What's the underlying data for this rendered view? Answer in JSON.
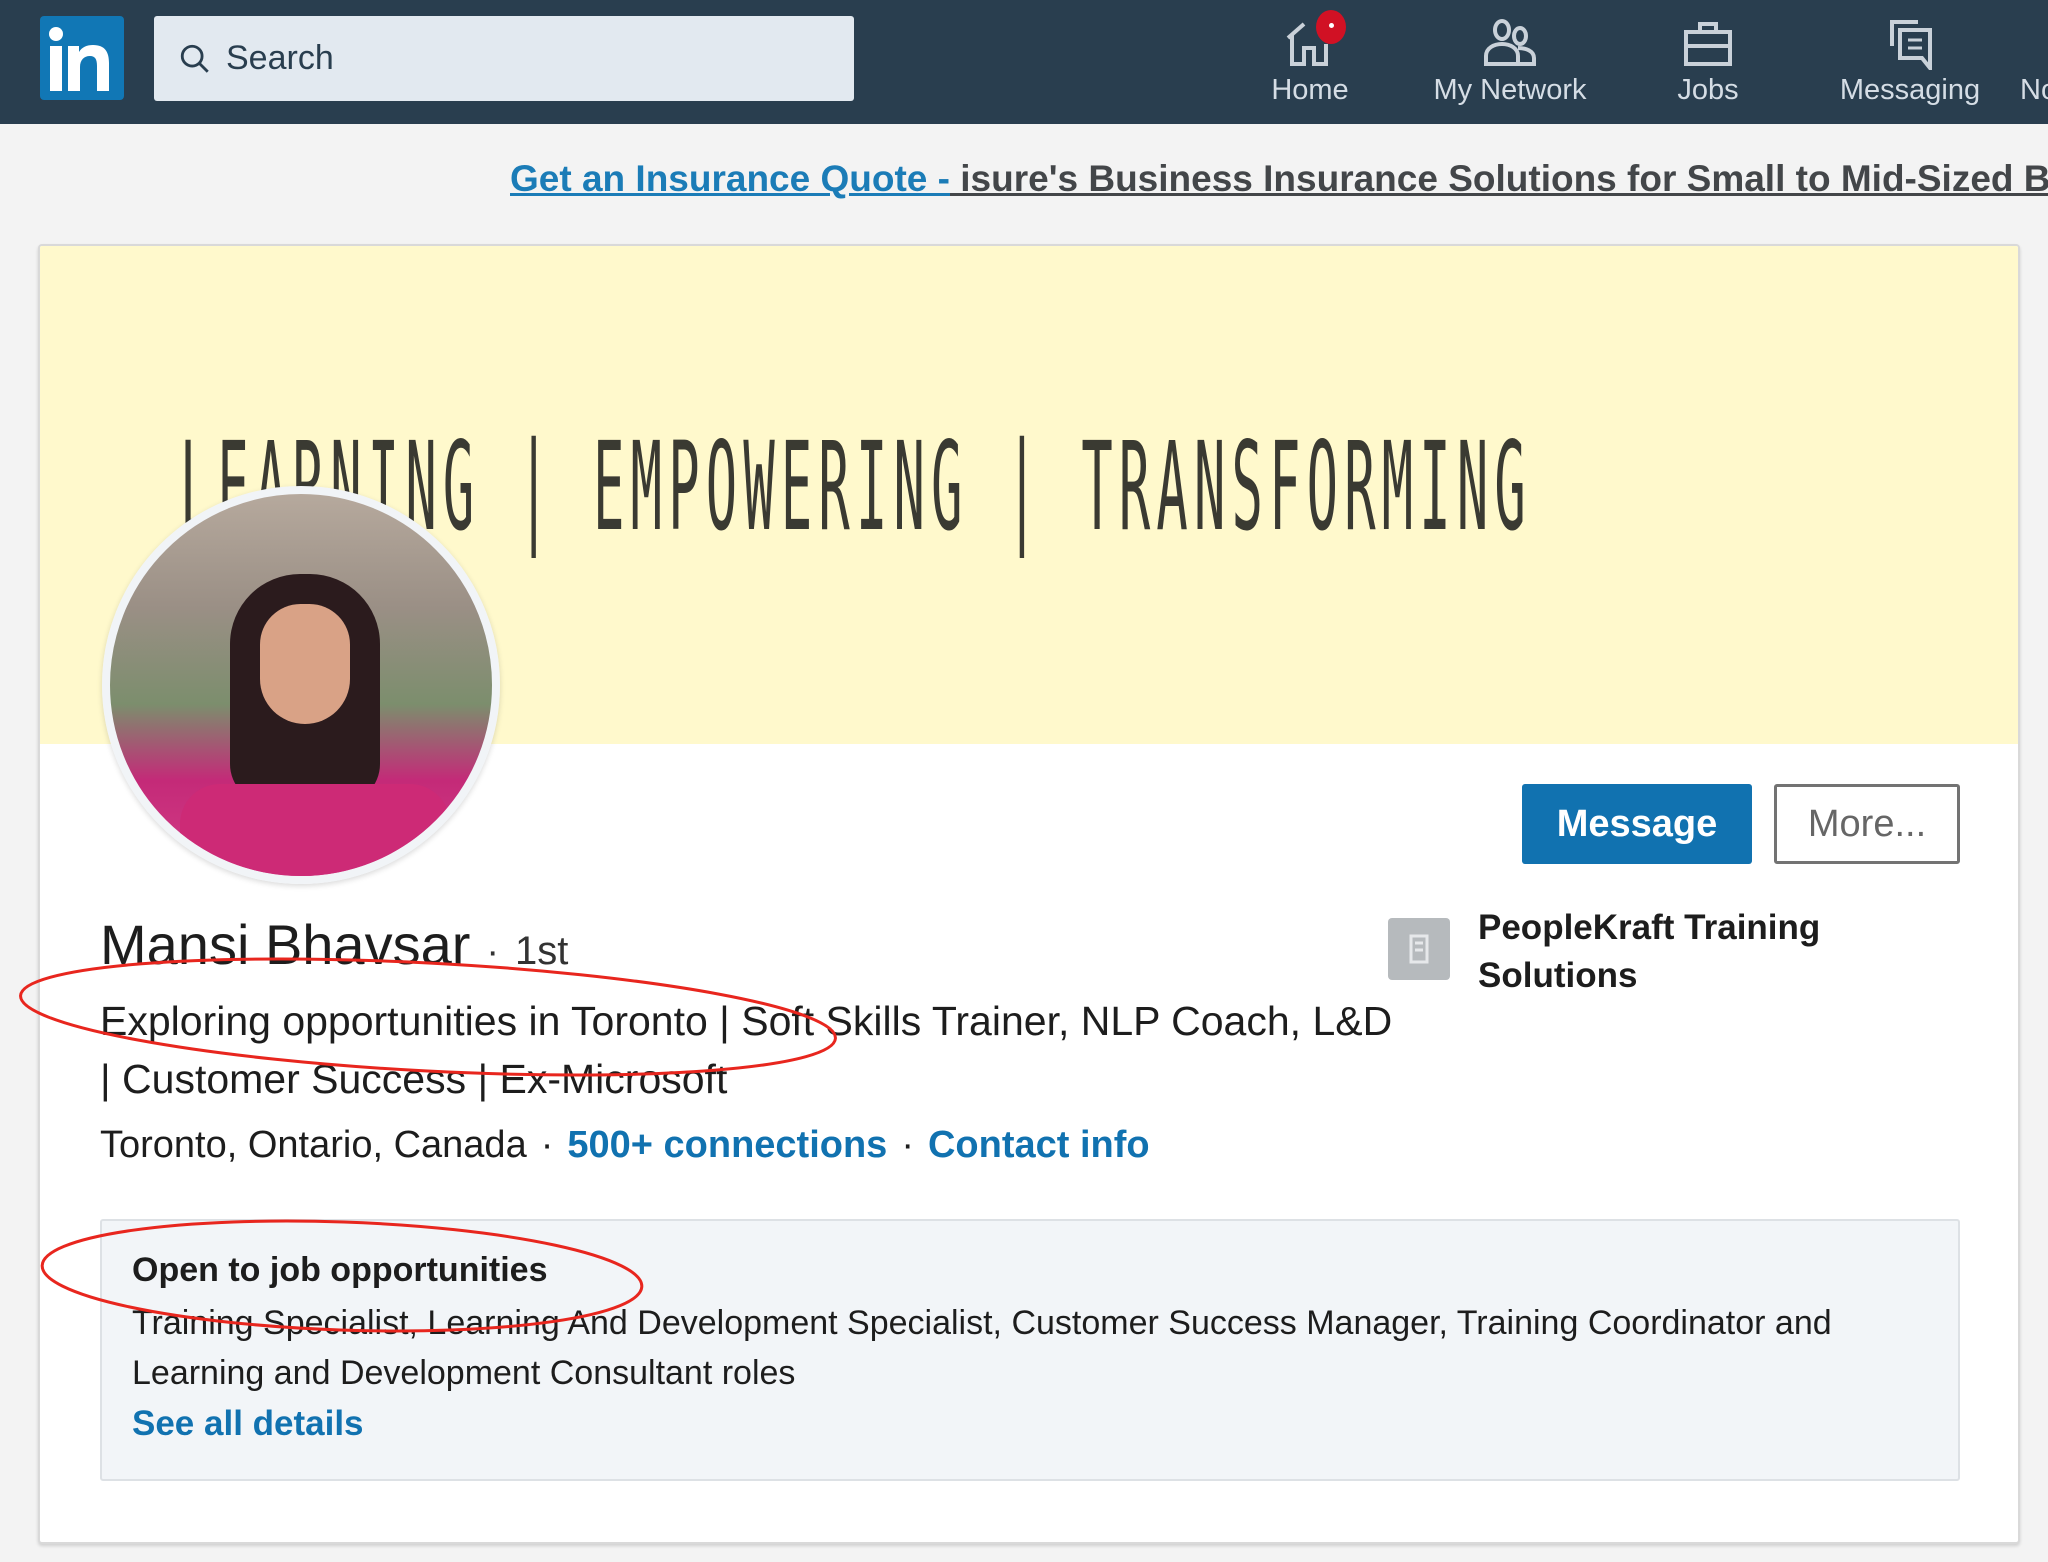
{
  "nav": {
    "logo": "in",
    "search_placeholder": "Search",
    "items": [
      {
        "label": "Home",
        "icon": "home-icon",
        "has_badge": true
      },
      {
        "label": "My Network",
        "icon": "people-icon"
      },
      {
        "label": "Jobs",
        "icon": "briefcase-icon"
      },
      {
        "label": "Messaging",
        "icon": "messaging-icon"
      },
      {
        "label": "No",
        "icon": "notifications-icon"
      }
    ]
  },
  "ad": {
    "link_text": "Get an Insurance Quote -",
    "rest_text": " isure's Business Insurance Solutions for Small to Mid-Sized Businesses"
  },
  "profile": {
    "banner_text": "LEARNING | EMPOWERING | TRANSFORMING",
    "name": "Mansi Bhavsar",
    "separator": "·",
    "degree": "1st",
    "headline": "Exploring opportunities in Toronto | Soft Skills Trainer, NLP Coach, L&D | Customer Success | Ex-Microsoft",
    "location": "Toronto, Ontario, Canada",
    "connections": "500+ connections",
    "contact_info": "Contact info",
    "message_button": "Message",
    "more_button": "More...",
    "company": "PeopleKraft Training Solutions"
  },
  "open_to_jobs": {
    "title": "Open to job opportunities",
    "roles": "Training Specialist, Learning And Development Specialist, Customer Success Manager, Training Coordinator and Learning and Development Consultant roles",
    "see_all": "See all details"
  },
  "colors": {
    "nav_bg": "#293e4f",
    "brand_blue": "#1172b0",
    "banner_bg": "#fff9cc",
    "badge_red": "#d11124",
    "annotation_red": "#e8261e"
  }
}
